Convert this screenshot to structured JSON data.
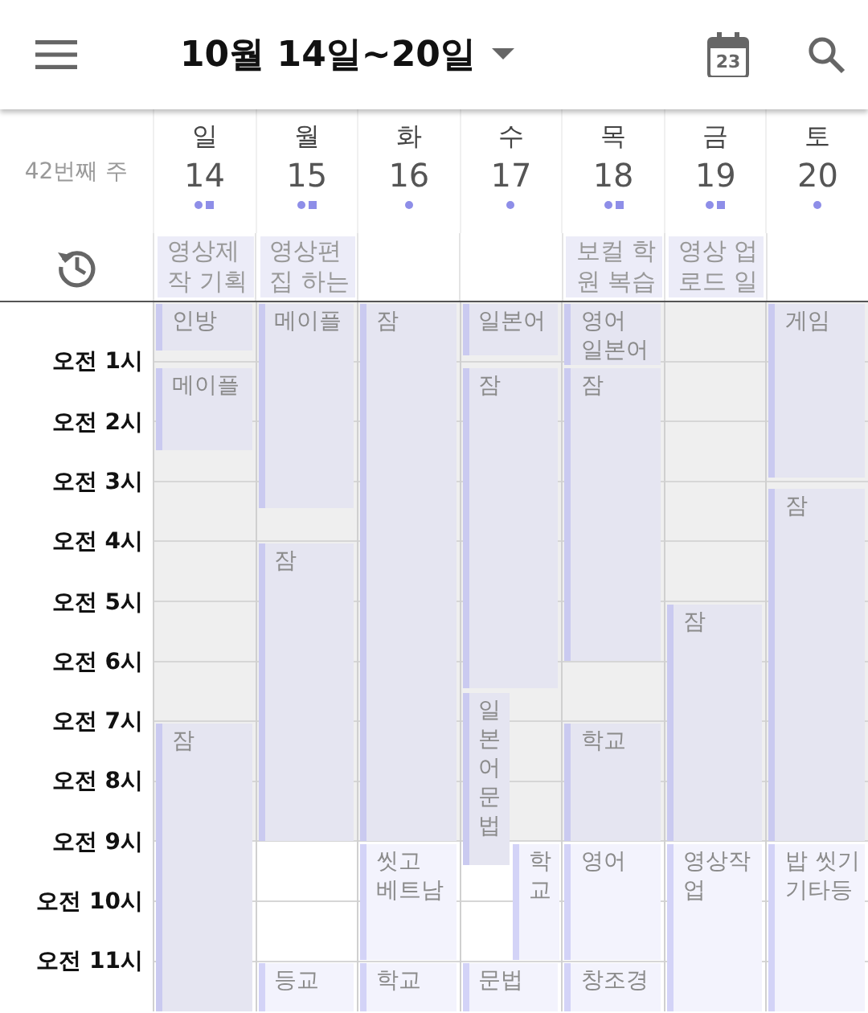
{
  "header": {
    "title": "10월 14일~20일",
    "today_day": "23"
  },
  "week_label": "42번째 주",
  "hours": [
    "오전 1시",
    "오전 2시",
    "오전 3시",
    "오전 4시",
    "오전 5시",
    "오전 6시",
    "오전 7시",
    "오전 8시",
    "오전 9시",
    "오전 10시",
    "오전 11시"
  ],
  "days": [
    {
      "weekday": "일",
      "date": "14",
      "indicators": [
        {
          "kind": "dot"
        },
        {
          "kind": "square"
        }
      ],
      "all_day": [
        {
          "title": "영상제작 기획"
        }
      ],
      "events": [
        {
          "title": "인방",
          "dimmed": true
        },
        {
          "title": "메이플",
          "dimmed": true
        },
        {
          "title": "잠",
          "dimmed": true
        }
      ]
    },
    {
      "weekday": "월",
      "date": "15",
      "indicators": [
        {
          "kind": "dot"
        },
        {
          "kind": "square"
        }
      ],
      "all_day": [
        {
          "title": "영상편집 하는"
        }
      ],
      "events": [
        {
          "title": "메이플",
          "dimmed": true
        },
        {
          "title": "잠",
          "dimmed": true
        },
        {
          "title": "등교",
          "dimmed": false
        }
      ]
    },
    {
      "weekday": "화",
      "date": "16",
      "indicators": [
        {
          "kind": "dot"
        }
      ],
      "events": [
        {
          "title": "잠",
          "dimmed": true
        },
        {
          "title": "씻고 베트남",
          "dimmed": false
        },
        {
          "title": "학교",
          "dimmed": false
        }
      ]
    },
    {
      "weekday": "수",
      "date": "17",
      "indicators": [
        {
          "kind": "dot"
        }
      ],
      "events": [
        {
          "title": "일본어",
          "dimmed": true
        },
        {
          "title": "잠",
          "dimmed": true
        },
        {
          "title": "일본어문법",
          "dimmed": true
        },
        {
          "title": "학교",
          "dimmed": false
        },
        {
          "title": "문법",
          "dimmed": false
        }
      ]
    },
    {
      "weekday": "목",
      "date": "18",
      "indicators": [
        {
          "kind": "dot"
        },
        {
          "kind": "square"
        }
      ],
      "all_day": [
        {
          "title": "보컬 학원 복습"
        }
      ],
      "events": [
        {
          "title": "영어 일본어",
          "dimmed": true
        },
        {
          "title": "잠",
          "dimmed": true
        },
        {
          "title": "학교",
          "dimmed": true
        },
        {
          "title": "영어",
          "dimmed": false
        },
        {
          "title": "창조경",
          "dimmed": false
        }
      ]
    },
    {
      "weekday": "금",
      "date": "19",
      "indicators": [
        {
          "kind": "dot"
        },
        {
          "kind": "square"
        }
      ],
      "all_day": [
        {
          "title": "영상 업로드 일"
        }
      ],
      "events": [
        {
          "title": "잠",
          "dimmed": true
        },
        {
          "title": "영상작업",
          "dimmed": false
        }
      ]
    },
    {
      "weekday": "토",
      "date": "20",
      "indicators": [
        {
          "kind": "dot"
        }
      ],
      "events": [
        {
          "title": "게임",
          "dimmed": true
        },
        {
          "title": "잠",
          "dimmed": true
        },
        {
          "title": "밥 씻기 기타등",
          "dimmed": false
        }
      ]
    }
  ]
}
